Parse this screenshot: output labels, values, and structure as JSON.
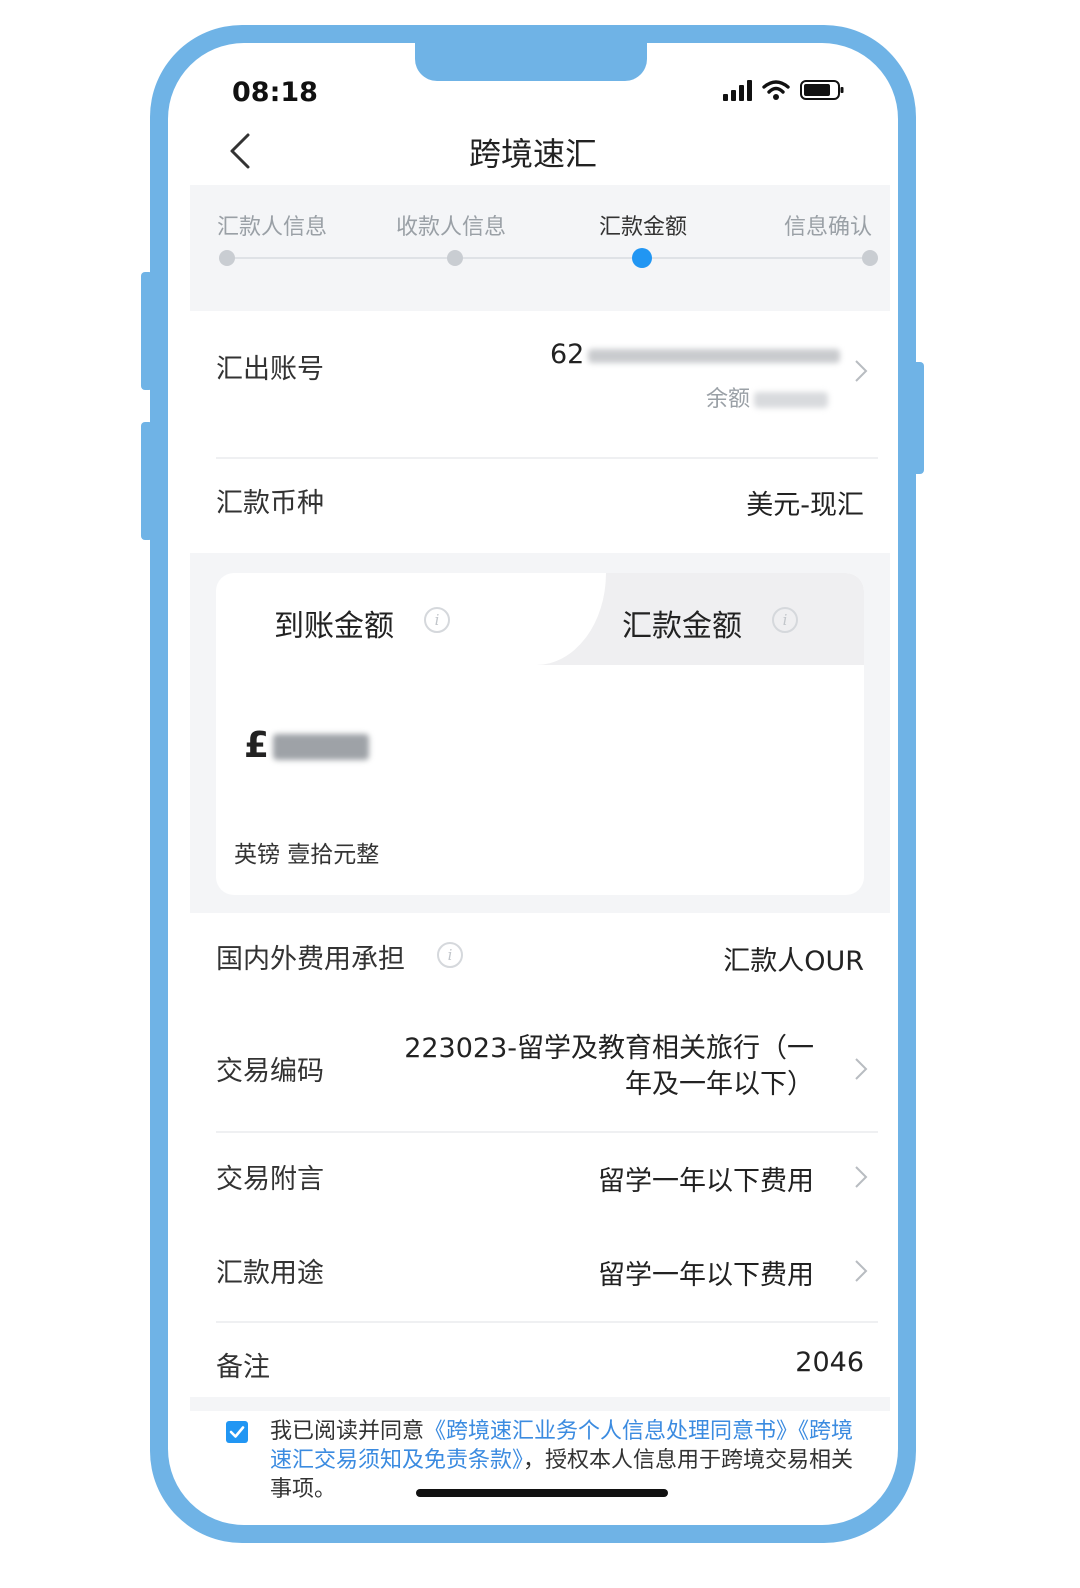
{
  "status_bar": {
    "time": "08:18"
  },
  "nav": {
    "title": "跨境速汇",
    "back_icon": "chevron-left-icon"
  },
  "stepper": {
    "steps": [
      {
        "label": "汇款人信息",
        "state": "done"
      },
      {
        "label": "收款人信息",
        "state": "done"
      },
      {
        "label": "汇款金额",
        "state": "active"
      },
      {
        "label": "信息确认",
        "state": "todo"
      }
    ],
    "active_color": "#2196f3"
  },
  "account": {
    "label": "汇出账号",
    "number_prefix": "62",
    "balance_label": "余额"
  },
  "currency": {
    "label": "汇款币种",
    "value": "美元-现汇"
  },
  "amount_card": {
    "tab_receive": "到账金额",
    "tab_remit": "汇款金额",
    "currency_symbol": "£",
    "amount_in_words": "英镑 壹拾元整"
  },
  "fees": {
    "label": "国内外费用承担",
    "value": "汇款人OUR"
  },
  "trade_code": {
    "label": "交易编码",
    "value_line1": "223023-留学及教育相关旅行（一",
    "value_line2": "年及一年以下）"
  },
  "trade_note": {
    "label": "交易附言",
    "value": "留学一年以下费用"
  },
  "purpose": {
    "label": "汇款用途",
    "value": "留学一年以下费用"
  },
  "remark": {
    "label": "备注",
    "value": "2046"
  },
  "agreement": {
    "checked": true,
    "prefix": "我已阅读并同意",
    "link1": "《跨境速汇业务个人信息处理同意书》",
    "link2": "《跨境速汇交易须知及免责条款》",
    "suffix": "，授权本人信息用于跨境交易相关事项。"
  },
  "colors": {
    "frame": "#6fb3e6",
    "link": "#3b8be0",
    "accent": "#2196f3"
  }
}
